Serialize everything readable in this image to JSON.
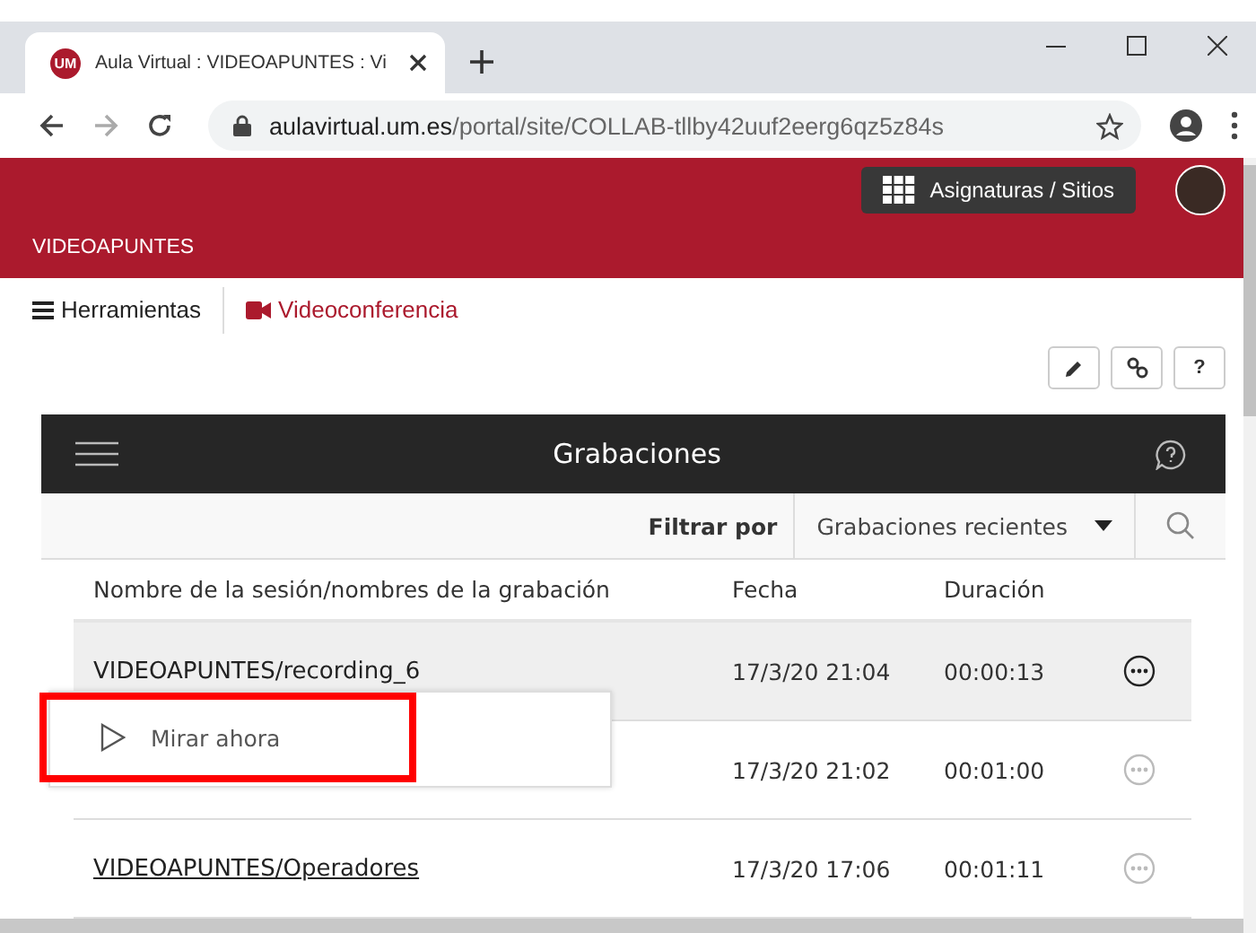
{
  "browser": {
    "tab_title": "Aula Virtual : VIDEOAPUNTES : Vi",
    "url_host": "aulavirtual.um.es",
    "url_path": "/portal/site/COLLAB-tllby42uuf2eerg6qz5z84s",
    "tab_logo": "UM"
  },
  "header": {
    "sites_button": "Asignaturas / Sitios",
    "site_title": "VIDEOAPUNTES"
  },
  "nav": [
    {
      "label": "Herramientas",
      "kind": "menu",
      "selected": false
    },
    {
      "label": "Videoconferencia",
      "kind": "video",
      "selected": true
    }
  ],
  "tool_buttons": [
    {
      "kind": "edit"
    },
    {
      "kind": "link"
    },
    {
      "kind": "help",
      "label": "?"
    }
  ],
  "panel": {
    "title": "Grabaciones",
    "filter_label": "Filtrar por",
    "filter_value": "Grabaciones recientes"
  },
  "table": {
    "columns": [
      "Nombre de la sesión/nombres de la grabación",
      "Fecha",
      "Duración"
    ],
    "rows": [
      {
        "name": "VIDEOAPUNTES/recording_6",
        "date": "17/3/20 21:04",
        "duration": "00:00:13",
        "selected": true
      },
      {
        "date": "17/3/20 21:02",
        "duration": "00:01:00",
        "selected": false
      },
      {
        "name": "VIDEOAPUNTES/Operadores",
        "date": "17/3/20 17:06",
        "duration": "00:01:11",
        "selected": false
      }
    ]
  },
  "context_menu": {
    "item": "Mirar ahora",
    "highlighted": true
  }
}
